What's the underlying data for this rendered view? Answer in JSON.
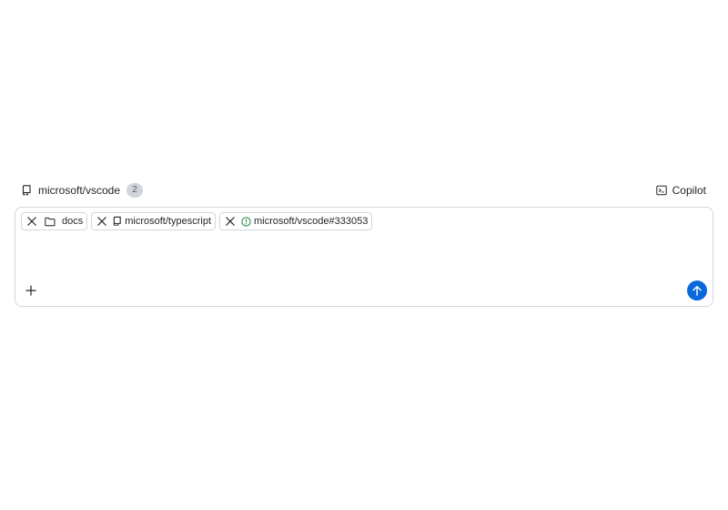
{
  "header": {
    "repo_name": "microsoft/vscode",
    "repo_icon": "repo-icon",
    "repo_count": "2",
    "copilot_label": "Copilot",
    "copilot_icon": "terminal-icon"
  },
  "composer": {
    "chips": [
      {
        "label": "docs",
        "icon": "folder-icon"
      },
      {
        "label": "microsoft/typescript",
        "icon": "repo-icon"
      },
      {
        "label": "microsoft/vscode#333053",
        "icon": "issue-open-icon"
      }
    ],
    "input_value": "",
    "add_icon": "plus-icon",
    "send_icon": "arrow-up-icon"
  },
  "colors": {
    "accent": "#0969da",
    "issue_open": "#1a7f37",
    "border": "#d0d7de",
    "text": "#1f2328"
  }
}
